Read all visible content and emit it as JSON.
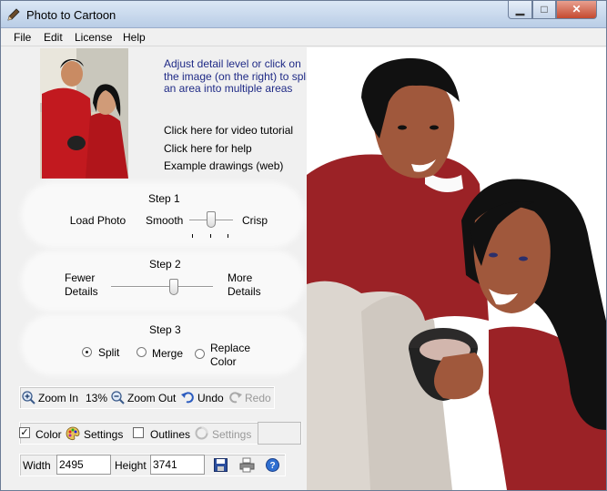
{
  "window": {
    "title": "Photo to Cartoon"
  },
  "menu": [
    "File",
    "Edit",
    "License",
    "Help"
  ],
  "info": {
    "instructions": [
      "Adjust detail level or click on",
      "the image (on the right) to split",
      "an area into multiple areas"
    ],
    "video": "Click here for video tutorial",
    "help": "Click here for help",
    "examples": "Example drawings (web)"
  },
  "step1": {
    "title": "Step 1",
    "load": "Load Photo",
    "left": "Smooth",
    "right": "Crisp",
    "slider_value": 0.5
  },
  "step2": {
    "title": "Step 2",
    "left1": "Fewer",
    "left2": "Details",
    "right1": "More",
    "right2": "Details",
    "slider_value": 0.62
  },
  "step3": {
    "title": "Step 3",
    "opt1": "Split",
    "opt2": "Merge",
    "opt3a": "Replace",
    "opt3b": "Color",
    "selected": "Split"
  },
  "zoom": {
    "zoom_in": "Zoom In",
    "percent": "13%",
    "zoom_out": "Zoom Out",
    "undo": "Undo",
    "redo": "Redo"
  },
  "color": {
    "color_label": "Color",
    "color_checked": true,
    "settings": "Settings",
    "outlines": "Outlines",
    "outlines_checked": false,
    "settings2": "Settings"
  },
  "size": {
    "width_label": "Width",
    "width_value": "2495",
    "height_label": "Height",
    "height_value": "3741"
  },
  "colors": {
    "accent": "#1f2a86",
    "shirt_red": "#9b2226",
    "skin": "#a0583c",
    "hair": "#111111"
  }
}
